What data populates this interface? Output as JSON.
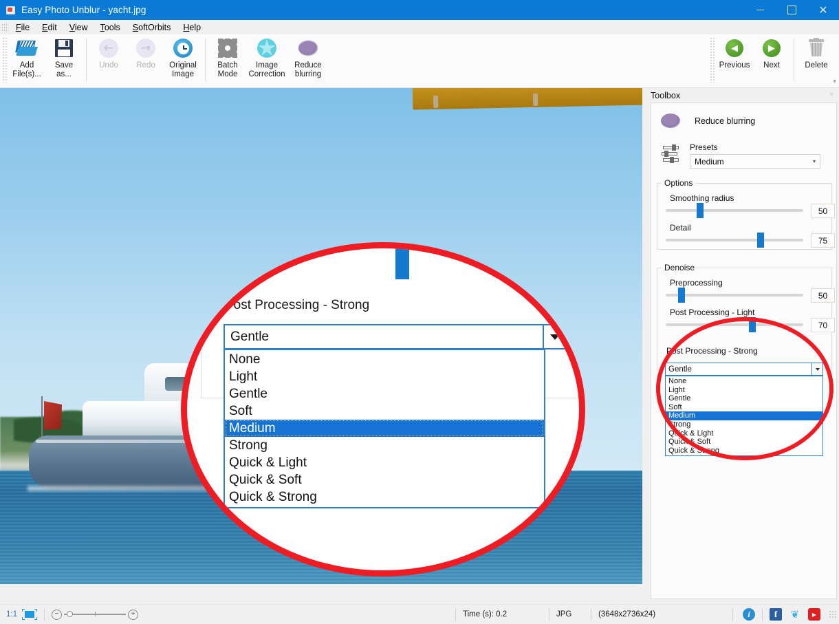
{
  "window": {
    "title": "Easy Photo Unblur - yacht.jpg",
    "app_icon": "photo-app-icon",
    "minimize": "–",
    "maximize": "□",
    "close": "✕",
    "titlebar_color": "#0a7ad4"
  },
  "menubar": {
    "items": [
      {
        "label": "File",
        "mnemonic": "F"
      },
      {
        "label": "Edit",
        "mnemonic": "E"
      },
      {
        "label": "View",
        "mnemonic": "V"
      },
      {
        "label": "Tools",
        "mnemonic": "T"
      },
      {
        "label": "SoftOrbits",
        "mnemonic": "S"
      },
      {
        "label": "Help",
        "mnemonic": "H"
      }
    ]
  },
  "toolbar": {
    "buttons": [
      {
        "label": "Add File(s)...",
        "line1": "Add",
        "line2": "File(s)...",
        "icon": "open-folder-icon",
        "disabled": false
      },
      {
        "label": "Save as...",
        "line1": "Save",
        "line2": "as...",
        "icon": "floppy-save-icon",
        "disabled": false
      },
      {
        "label": "Undo",
        "line1": "Undo",
        "line2": "",
        "icon": "undo-arrow-icon",
        "disabled": true
      },
      {
        "label": "Redo",
        "line1": "Redo",
        "line2": "",
        "icon": "redo-arrow-icon",
        "disabled": true
      },
      {
        "label": "Original Image",
        "line1": "Original",
        "line2": "Image",
        "icon": "clock-history-icon",
        "disabled": false
      },
      {
        "label": "Batch Mode",
        "line1": "Batch",
        "line2": "Mode",
        "icon": "gear-icon",
        "disabled": false
      },
      {
        "label": "Image Correction",
        "line1": "Image",
        "line2": "Correction",
        "icon": "star-burst-icon",
        "disabled": false
      },
      {
        "label": "Reduce blurring",
        "line1": "Reduce",
        "line2": "blurring",
        "icon": "blur-blob-icon",
        "disabled": false
      }
    ],
    "right_buttons": [
      {
        "label": "Previous",
        "icon": "arrow-left-circle-icon"
      },
      {
        "label": "Next",
        "icon": "arrow-right-circle-icon"
      },
      {
        "label": "Delete",
        "icon": "trash-icon"
      }
    ],
    "expander": "▾"
  },
  "canvas": {
    "image_name": "yacht.jpg",
    "description": "Blue motor yacht moored on calm sea under clear sky"
  },
  "magnifier": {
    "label": "Post Processing - Strong",
    "combo_value": "Gentle",
    "dropdown_arrow": "▾",
    "options": [
      "None",
      "Light",
      "Gentle",
      "Soft",
      "Medium",
      "Strong",
      "Quick & Light",
      "Quick & Soft",
      "Quick & Strong"
    ],
    "selected_option": "Medium",
    "ring_color": "#ee1c23"
  },
  "toolbox": {
    "header": "Toolbox",
    "close": "×",
    "tool_title": "Reduce blurring",
    "tool_icon": "blur-blob-icon",
    "presets_icon": "sliders-icon",
    "presets_label": "Presets",
    "presets_value": "Medium",
    "presets_arrow": "▾",
    "groups": [
      {
        "legend": "Options",
        "sliders": [
          {
            "label": "Smoothing radius",
            "value": "50",
            "percent": 24
          },
          {
            "label": "Detail",
            "value": "75",
            "percent": 70
          }
        ]
      },
      {
        "legend": "Denoise",
        "sliders": [
          {
            "label": "Preprocessing",
            "value": "50",
            "percent": 9
          },
          {
            "label": "Post Processing - Light",
            "value": "70",
            "percent": 56
          }
        ]
      }
    ],
    "post_strong": {
      "label": "Post Processing - Strong",
      "combo_value": "Gentle",
      "dropdown_arrow": "▾",
      "options": [
        "None",
        "Light",
        "Gentle",
        "Soft",
        "Medium",
        "Strong",
        "Quick & Light",
        "Quick & Soft",
        "Quick & Strong"
      ],
      "selected_option": "Medium"
    },
    "highlight_ring_color": "#ee1c23"
  },
  "statusbar": {
    "zoom_ratio": "1:1",
    "fit_icon": "fit-to-window-icon",
    "zoom_out": "−",
    "zoom_in": "+",
    "time": "Time (s): 0.2",
    "format": "JPG",
    "dimensions": "(3648x2736x24)",
    "social": [
      {
        "icon": "info-icon",
        "glyph": "i"
      },
      {
        "icon": "facebook-icon",
        "glyph": "f"
      },
      {
        "icon": "twitter-icon",
        "glyph": "❦"
      },
      {
        "icon": "youtube-icon",
        "glyph": "▶"
      }
    ]
  }
}
